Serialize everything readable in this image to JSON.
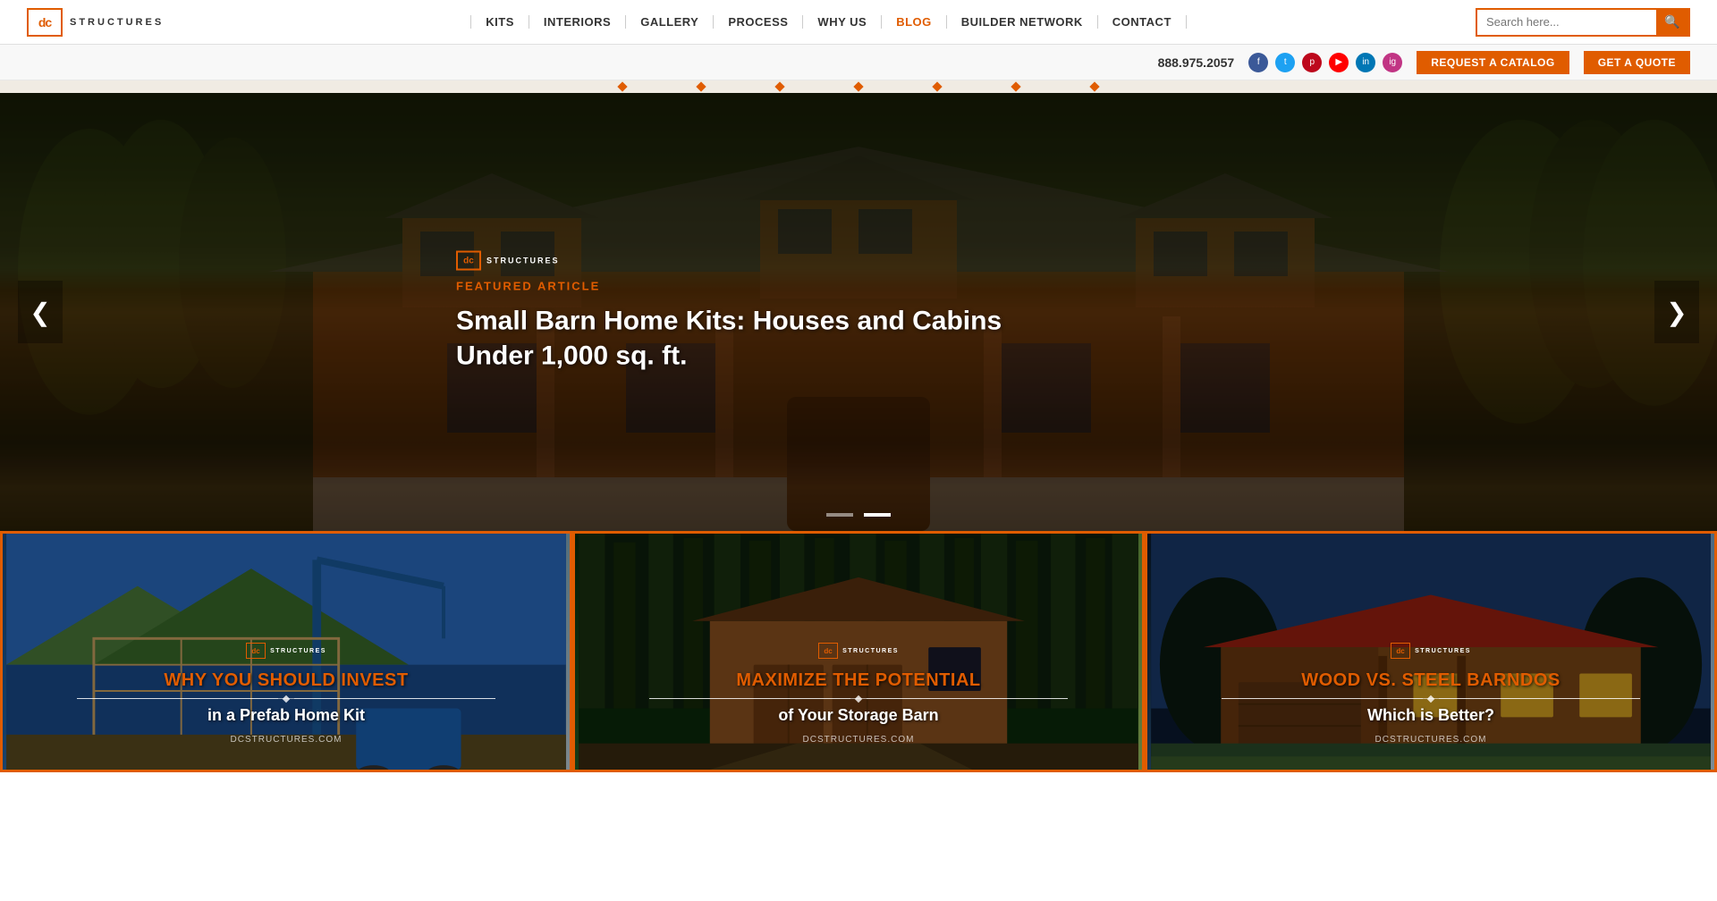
{
  "header": {
    "logo": {
      "dc": "dc",
      "brand": "STRUCTURES"
    },
    "nav": [
      {
        "label": "KITS",
        "active": false
      },
      {
        "label": "INTERIORS",
        "active": false
      },
      {
        "label": "GALLERY",
        "active": false
      },
      {
        "label": "PROCESS",
        "active": false
      },
      {
        "label": "WHY US",
        "active": false
      },
      {
        "label": "BLOG",
        "active": true
      },
      {
        "label": "BUILDER NETWORK",
        "active": false
      },
      {
        "label": "CONTACT",
        "active": false
      }
    ],
    "search_placeholder": "Search here...",
    "phone": "888.975.2057",
    "catalog_btn": "REQUEST A CATALOG",
    "quote_btn": "GET A QUOTE"
  },
  "hero": {
    "logo_dc": "dc",
    "logo_brand": "STRUCTURES",
    "featured_label": "FEATURED ARTICLE",
    "title": "Small Barn Home Kits: Houses and Cabins Under 1,000 sq. ft.",
    "prev_arrow": "❮",
    "next_arrow": "❯",
    "dots": [
      {
        "active": false
      },
      {
        "active": true
      }
    ]
  },
  "blog_cards": [
    {
      "logo_dc": "dc",
      "logo_brand": "STRUCTURES",
      "title_top": "WHY YOU SHOULD INVEST",
      "title_bottom": "in a Prefab Home Kit",
      "url": "DCSTRUCTURES.COM"
    },
    {
      "logo_dc": "dc",
      "logo_brand": "STRUCTURES",
      "title_top": "MAXIMIZE THE POTENTIAL",
      "title_bottom": "of Your Storage Barn",
      "url": "DCSTRUCTURES.COM"
    },
    {
      "logo_dc": "dc",
      "logo_brand": "STRUCTURES",
      "title_top": "WOOD VS. STEEL BARNDOS",
      "title_bottom": "Which is Better?",
      "url": "DCSTRUCTURES.COM"
    }
  ],
  "social_icons": [
    "f",
    "t",
    "p",
    "▶",
    "in",
    "ig"
  ],
  "nav_dots_count": 7
}
